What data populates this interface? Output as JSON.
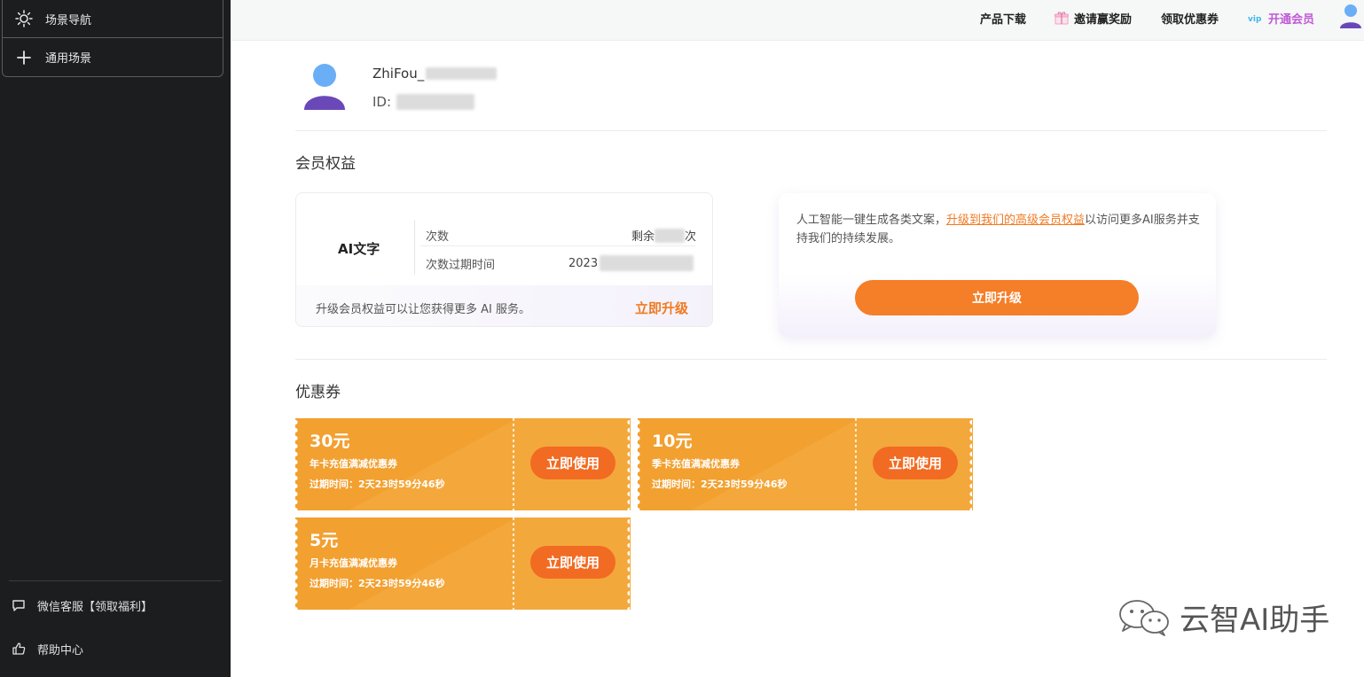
{
  "sidebar": {
    "nav_items": [
      {
        "label": "场景导航",
        "icon": "sun-icon"
      },
      {
        "label": "通用场景",
        "icon": "plus-icon"
      }
    ],
    "bottom_items": [
      {
        "label": "微信客服【领取福利】",
        "icon": "chat-icon"
      },
      {
        "label": "帮助中心",
        "icon": "thumbs-up-icon"
      }
    ]
  },
  "topbar": {
    "download": "产品下载",
    "invite": "邀请赢奖励",
    "coupon": "领取优惠券",
    "vip": "开通会员",
    "vip_color": "#c05ad6"
  },
  "profile": {
    "username_prefix": "ZhiFou_",
    "id_label": "ID:"
  },
  "membership": {
    "title": "会员权益",
    "product": "AI文字",
    "count_label": "次数",
    "remaining_prefix": "剩余",
    "remaining_suffix": "次",
    "expiry_label": "次数过期时间",
    "expiry_value_prefix": "2023",
    "bottom_text": "升级会员权益可以让您获得更多 AI 服务。",
    "upgrade_link": "立即升级",
    "accent_color": "#f07a22"
  },
  "promo": {
    "text_before": "人工智能一键生成各类文案，",
    "link": "升级到我们的高级会员权益",
    "text_after": "以访问更多AI服务并支持我们的持续发展。",
    "button": "立即升级",
    "button_color": "#f57e28"
  },
  "coupons": {
    "title": "优惠券",
    "items": [
      {
        "amount": "30元",
        "desc": "年卡充值满减优惠券",
        "expiry": "过期时间：2天23时59分46秒",
        "button": "立即使用"
      },
      {
        "amount": "10元",
        "desc": "季卡充值满减优惠券",
        "expiry": "过期时间：2天23时59分46秒",
        "button": "立即使用"
      },
      {
        "amount": "5元",
        "desc": "月卡充值满减优惠券",
        "expiry": "过期时间：2天23时59分46秒",
        "button": "立即使用"
      }
    ],
    "coupon_color": "#f2a030"
  },
  "watermark": {
    "text": "云智AI助手",
    "icon": "wechat-icon"
  }
}
